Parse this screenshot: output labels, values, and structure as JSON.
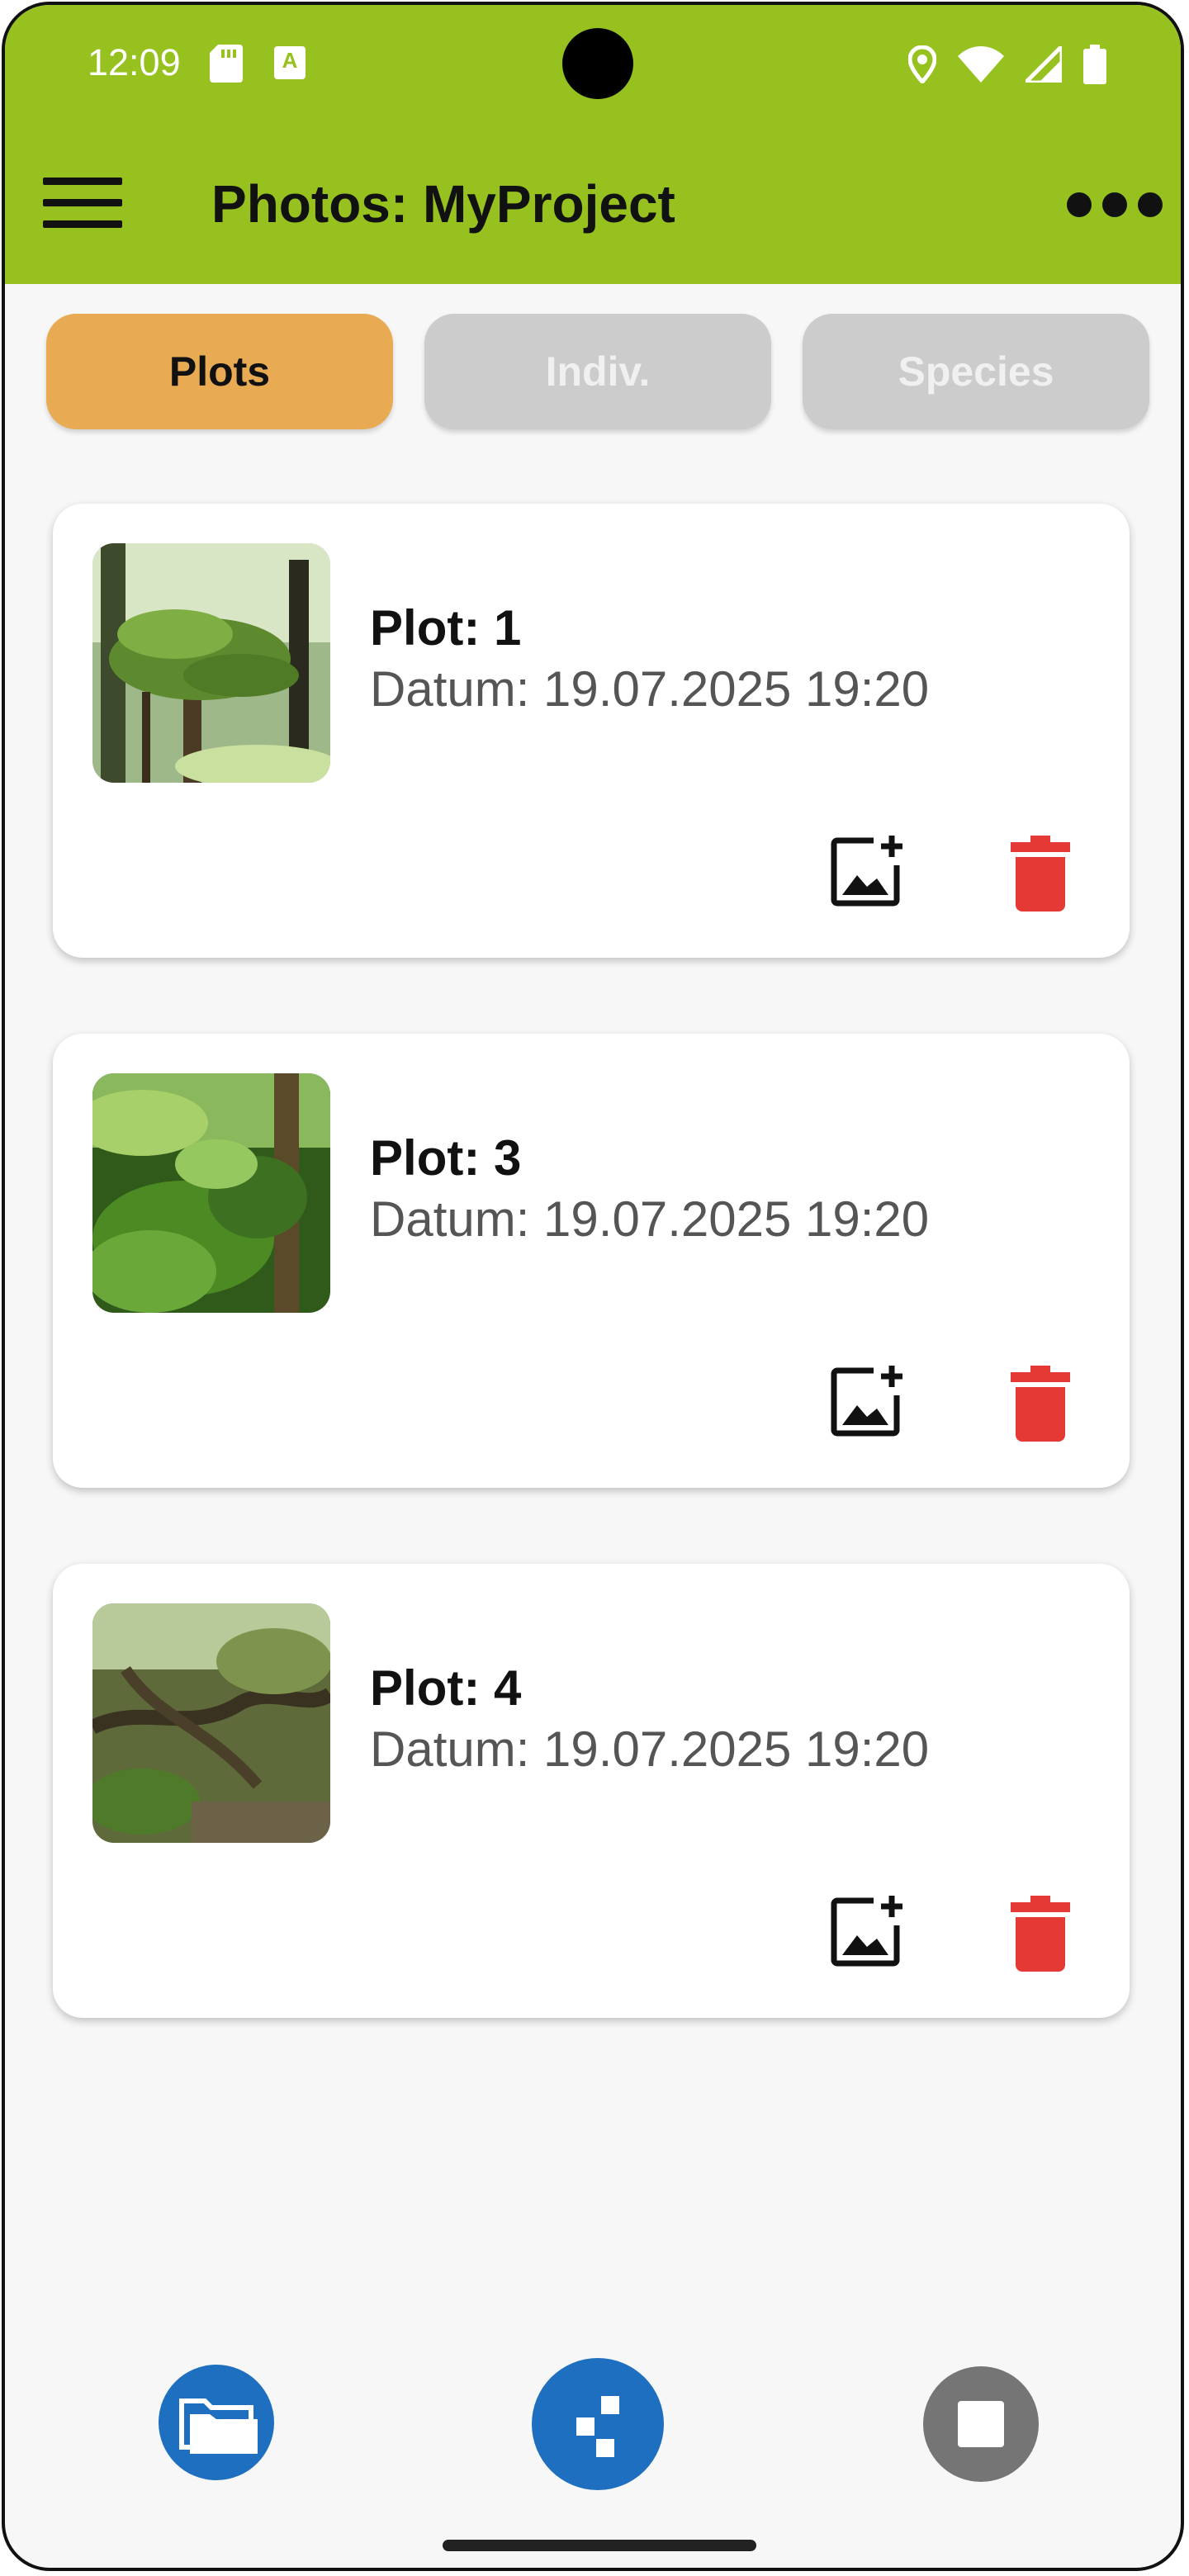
{
  "status_bar": {
    "time": "12:09",
    "icons": [
      "sd-card-icon",
      "a-notification-icon",
      "location-icon",
      "wifi-icon",
      "signal-icon",
      "battery-icon"
    ]
  },
  "app_bar": {
    "title": "Photos: MyProject",
    "menu_icon": "hamburger-menu-icon",
    "more_icon": "more-horizontal-icon",
    "color": "#96c11f"
  },
  "tabs": [
    {
      "label": "Plots",
      "active": true
    },
    {
      "label": "Indiv.",
      "active": false
    },
    {
      "label": "Species",
      "active": false
    }
  ],
  "cards": [
    {
      "title": "Plot: 1",
      "date": "Datum: 19.07.2025 19:20"
    },
    {
      "title": "Plot: 3",
      "date": "Datum: 19.07.2025 19:20"
    },
    {
      "title": "Plot: 4",
      "date": "Datum: 19.07.2025 19:20"
    }
  ],
  "colors": {
    "active_tab": "#e8ab53",
    "inactive_tab": "#cccccc",
    "delete": "#e53935",
    "fab_blue": "#1e6fbf",
    "fab_grey": "#757575"
  },
  "bottom_buttons": [
    "folder-icon",
    "pattern-icon",
    "stop-icon"
  ]
}
